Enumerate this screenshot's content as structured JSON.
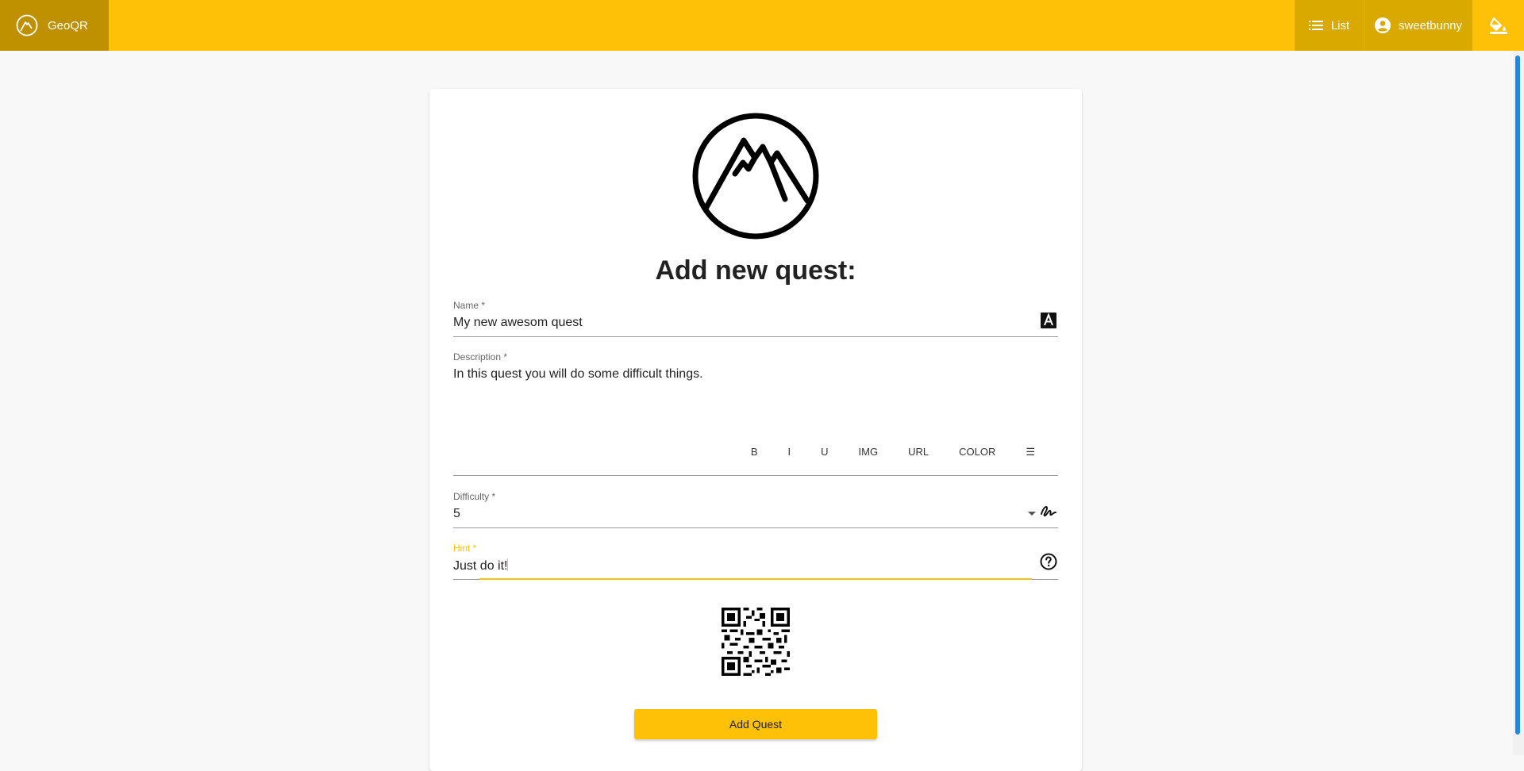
{
  "appbar": {
    "brand_label": "GeoQR",
    "list_label": "List",
    "user_label": "sweetbunny"
  },
  "page": {
    "title": "Add new quest:"
  },
  "form": {
    "name_label": "Name *",
    "name_value": "My new awesom quest",
    "description_label": "Description *",
    "description_value": "In this quest you will do some difficult things.",
    "toolbar": [
      "B",
      "I",
      "U",
      "IMG",
      "URL",
      "COLOR",
      "☰"
    ],
    "difficulty_label": "Difficulty *",
    "difficulty_value": "5",
    "hint_label": "Hint *",
    "hint_value": "Just do it!"
  },
  "actions": {
    "submit_label": "Add Quest"
  },
  "colors": {
    "accent": "#ffc107",
    "brand_dark": "#bf9000",
    "scrollbar": "#1e88e5"
  }
}
